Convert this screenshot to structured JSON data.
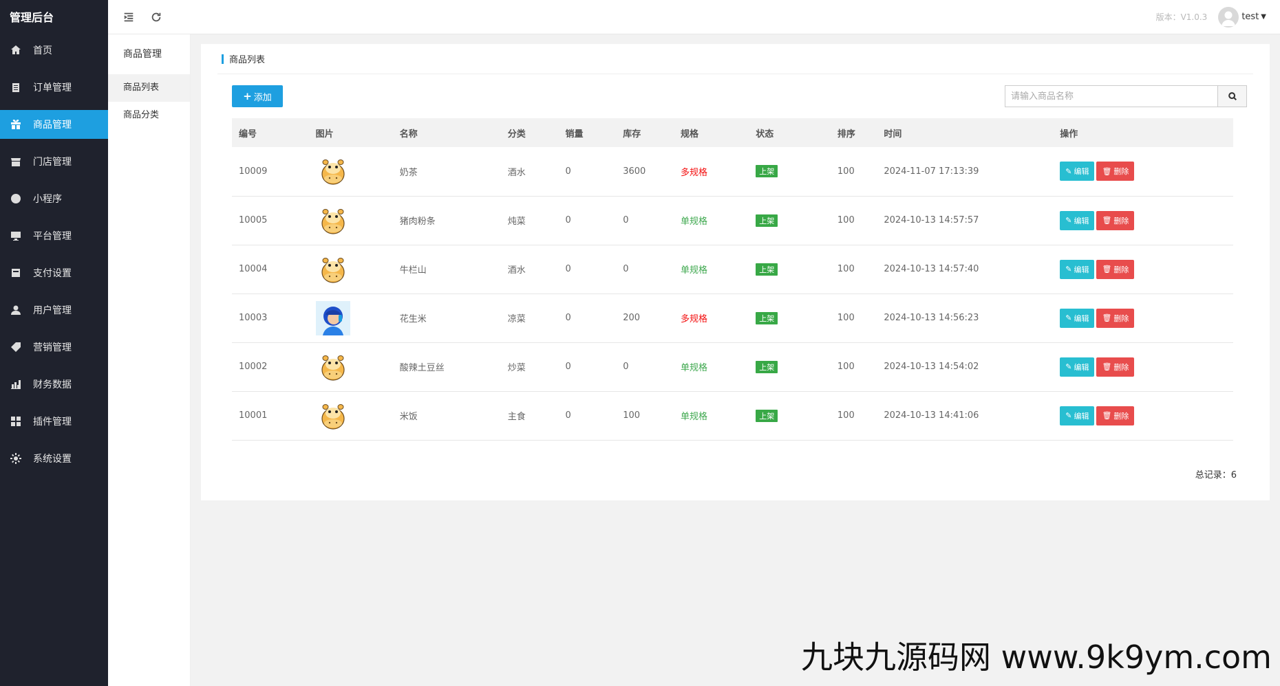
{
  "app": {
    "brand": "管理后台"
  },
  "sidebar": {
    "items": [
      {
        "label": "首页",
        "icon": "home-icon",
        "active": false
      },
      {
        "label": "订单管理",
        "icon": "clipboard-icon",
        "active": false
      },
      {
        "label": "商品管理",
        "icon": "gift-icon",
        "active": true
      },
      {
        "label": "门店管理",
        "icon": "store-icon",
        "active": false
      },
      {
        "label": "小程序",
        "icon": "miniprogram-icon",
        "active": false
      },
      {
        "label": "平台管理",
        "icon": "monitor-icon",
        "active": false
      },
      {
        "label": "支付设置",
        "icon": "wallet-icon",
        "active": false
      },
      {
        "label": "用户管理",
        "icon": "user-icon",
        "active": false
      },
      {
        "label": "营销管理",
        "icon": "tags-icon",
        "active": false
      },
      {
        "label": "财务数据",
        "icon": "bar-chart-icon",
        "active": false
      },
      {
        "label": "插件管理",
        "icon": "plugin-icon",
        "active": false
      },
      {
        "label": "系统设置",
        "icon": "gear-icon",
        "active": false
      }
    ]
  },
  "subnav": {
    "title": "商品管理",
    "items": [
      {
        "label": "商品列表",
        "active": true
      },
      {
        "label": "商品分类",
        "active": false
      }
    ]
  },
  "header": {
    "version": "版本：V1.0.3",
    "user": "test"
  },
  "card": {
    "title": "商品列表",
    "add_label": "添加",
    "search_placeholder": "请输入商品名称"
  },
  "table": {
    "columns": [
      "编号",
      "图片",
      "名称",
      "分类",
      "销量",
      "库存",
      "规格",
      "状态",
      "排序",
      "时间",
      "操作"
    ],
    "rows": [
      {
        "id": "10009",
        "image": "hippo",
        "name": "奶茶",
        "category": "酒水",
        "sales": "0",
        "stock": "3600",
        "spec": "多规格",
        "spec_type": "multi",
        "status": "上架",
        "sort": "100",
        "time": "2024-11-07 17:13:39"
      },
      {
        "id": "10005",
        "image": "hippo",
        "name": "猪肉粉条",
        "category": "炖菜",
        "sales": "0",
        "stock": "0",
        "spec": "单规格",
        "spec_type": "single",
        "status": "上架",
        "sort": "100",
        "time": "2024-10-13 14:57:57"
      },
      {
        "id": "10004",
        "image": "hippo",
        "name": "牛栏山",
        "category": "酒水",
        "sales": "0",
        "stock": "0",
        "spec": "单规格",
        "spec_type": "single",
        "status": "上架",
        "sort": "100",
        "time": "2024-10-13 14:57:40"
      },
      {
        "id": "10003",
        "image": "helmet-avatar",
        "name": "花生米",
        "category": "凉菜",
        "sales": "0",
        "stock": "200",
        "spec": "多规格",
        "spec_type": "multi",
        "status": "上架",
        "sort": "100",
        "time": "2024-10-13 14:56:23"
      },
      {
        "id": "10002",
        "image": "hippo",
        "name": "酸辣土豆丝",
        "category": "炒菜",
        "sales": "0",
        "stock": "0",
        "spec": "单规格",
        "spec_type": "single",
        "status": "上架",
        "sort": "100",
        "time": "2024-10-13 14:54:02"
      },
      {
        "id": "10001",
        "image": "hippo",
        "name": "米饭",
        "category": "主食",
        "sales": "0",
        "stock": "100",
        "spec": "单规格",
        "spec_type": "single",
        "status": "上架",
        "sort": "100",
        "time": "2024-10-13 14:41:06"
      }
    ],
    "edit_label": "编辑",
    "delete_label": "删除"
  },
  "footer": {
    "total": "总记录：6"
  },
  "watermark": "九块九源码网 www.9k9ym.com",
  "colors": {
    "sidebar_bg": "#1f222d",
    "accent": "#1e9fe0",
    "status_green": "#38a846",
    "spec_multi": "#f30f0f",
    "spec_single": "#3ea84e",
    "edit": "#28bed1",
    "delete": "#e84c4c"
  }
}
